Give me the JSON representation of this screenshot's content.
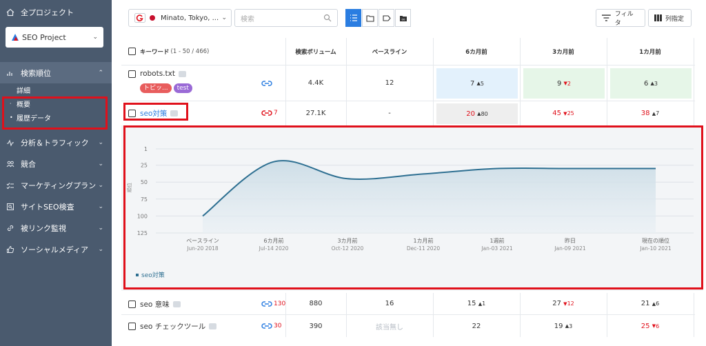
{
  "sidebar": {
    "all_projects": "全プロジェクト",
    "project": "SEO Project",
    "nav": [
      {
        "label": "検索順位",
        "icon": "bar-chart-icon"
      },
      {
        "label": "分析＆トラフィック",
        "icon": "pulse-icon"
      },
      {
        "label": "競合",
        "icon": "people-icon"
      },
      {
        "label": "マーケティングプラン",
        "icon": "checklist-icon"
      },
      {
        "label": "サイトSEO検査",
        "icon": "audit-icon"
      },
      {
        "label": "被リンク監視",
        "icon": "link-icon"
      },
      {
        "label": "ソーシャルメディア",
        "icon": "thumbs-up-icon"
      }
    ],
    "sub": [
      "詳細",
      "概要",
      "履歴データ"
    ]
  },
  "toolbar": {
    "location": "Minato, Tokyo, ...",
    "search_placeholder": "検索",
    "filter_label": "フィルタ",
    "columns_label": "列指定"
  },
  "table": {
    "headers": {
      "keyword": "キーワード",
      "keyword_count": "(1 - 50 / 466)",
      "volume": "検索ボリューム",
      "baseline": "ベースライン",
      "m6": "6カ月前",
      "m3": "3カ月前",
      "m1": "1カ月前"
    },
    "rows": [
      {
        "keyword": "robots.txt",
        "tags": [
          "トピッ...",
          "test"
        ],
        "links": "",
        "volume": "4.4K",
        "baseline": "12",
        "m6": "7",
        "m6d": "5",
        "m3": "9",
        "m3d": "2",
        "m1": "6",
        "m1d": "3"
      },
      {
        "keyword": "seo対策",
        "links": "7",
        "volume": "27.1K",
        "baseline": "-",
        "m6": "20",
        "m6d": "80",
        "m3": "45",
        "m3d": "25",
        "m1": "38",
        "m1d": "7"
      },
      {
        "keyword": "seo 意味",
        "links": "130",
        "volume": "880",
        "baseline": "16",
        "m6": "15",
        "m6d": "1",
        "m3": "27",
        "m3d": "12",
        "m1": "21",
        "m1d": "6"
      },
      {
        "keyword": "seo チェックツール",
        "links": "30",
        "volume": "390",
        "baseline": "該当無し",
        "m6": "22",
        "m6d": "",
        "m3": "19",
        "m3d": "3",
        "m1": "25",
        "m1d": "6"
      }
    ]
  },
  "chart_data": {
    "type": "area",
    "ylabel": "順位",
    "ylim": [
      1,
      125
    ],
    "y_inverted": true,
    "yticks": [
      1,
      25,
      50,
      75,
      100,
      125
    ],
    "categories": [
      {
        "label": "ベースライン",
        "date": "Jun-20 2018"
      },
      {
        "label": "6カ月前",
        "date": "Jul-14 2020"
      },
      {
        "label": "3カ月前",
        "date": "Oct-12 2020"
      },
      {
        "label": "1カ月前",
        "date": "Dec-11 2020"
      },
      {
        "label": "1週前",
        "date": "Jan-03 2021"
      },
      {
        "label": "昨日",
        "date": "Jan-09 2021"
      },
      {
        "label": "現在の順位",
        "date": "Jan-10 2021"
      }
    ],
    "series": [
      {
        "name": "seo対策",
        "values": [
          100,
          20,
          45,
          38,
          30,
          30,
          30
        ],
        "color": "#2d6f91"
      }
    ],
    "legend": "bottom-left"
  }
}
